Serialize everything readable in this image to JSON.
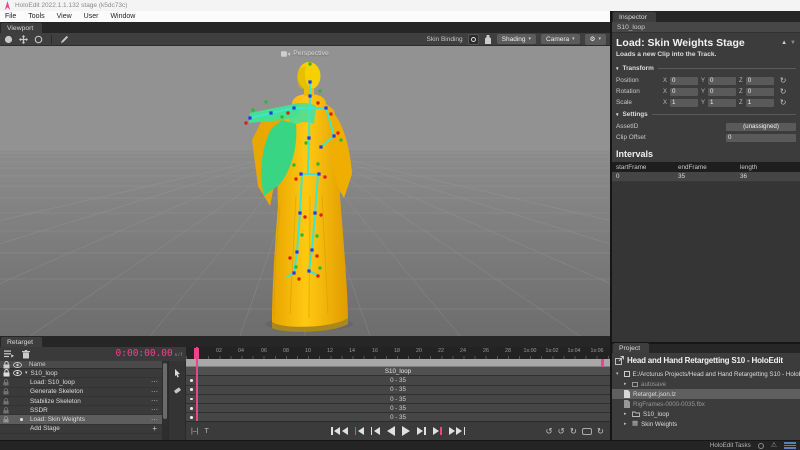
{
  "app": {
    "title": "HoloEdit 2022.1.1.132 stage (k5dc73c)"
  },
  "menu": {
    "items": [
      "File",
      "Tools",
      "View",
      "User",
      "Window"
    ]
  },
  "viewport": {
    "tab": "Viewport",
    "camera_label": "Perspective",
    "toolbar": {
      "skin_binding": "Skin Binding",
      "shading": "Shading",
      "camera": "Camera"
    }
  },
  "inspector": {
    "tab": "Inspector",
    "context": "S10_loop",
    "title": "Load: Skin Weights Stage",
    "subtitle": "Loads a new Clip into the Track.",
    "transform_section": "Transform",
    "axis_labels": {
      "x": "X",
      "y": "Y",
      "z": "Z"
    },
    "rows": [
      {
        "label": "Position",
        "x": "0",
        "y": "0",
        "z": "0"
      },
      {
        "label": "Rotation",
        "x": "0",
        "y": "0",
        "z": "0"
      },
      {
        "label": "Scale",
        "x": "1",
        "y": "1",
        "z": "1"
      }
    ],
    "settings_section": "Settings",
    "asset_id": {
      "label": "AssetID",
      "value": "(unassigned)"
    },
    "clip_offset": {
      "label": "Clip Offset",
      "value": "0"
    },
    "intervals": {
      "heading": "Intervals",
      "columns": [
        "startFrame",
        "endFrame",
        "length"
      ],
      "row": [
        "0",
        "35",
        "36"
      ]
    }
  },
  "retarget": {
    "tab": "Retarget",
    "timecode": "0:00:00.00",
    "timecode_units": "s / f",
    "name_header": "Name",
    "group_label": "S10_loop",
    "stages": [
      "Load: S10_loop",
      "Generate Skeleton",
      "Stabilize Skeleton",
      "SSDR",
      "Load: Skin Weights"
    ],
    "selected_stage": "Load: Skin Weights",
    "add_stage": "Add Stage",
    "more_glyph": "⋯",
    "plus_glyph": "+",
    "fit_glyph": "|–|",
    "text_tool_glyph": "T",
    "timeline": {
      "ticks": [
        "02",
        "04",
        "06",
        "08",
        "10",
        "12",
        "14",
        "16",
        "18",
        "20",
        "22",
        "24",
        "26",
        "28",
        "1s:00",
        "1s:02",
        "1s:04",
        "1s:06"
      ],
      "clip_label": "S10_loop",
      "range": "0 - 35"
    }
  },
  "project": {
    "tab": "Project",
    "title": "Head and Hand Retargetting S10 - HoloEdit",
    "root": "E:/Arcturus Projects/Head and Hand Retargetting S10 - HoloEdit",
    "items": [
      {
        "label": "autosave"
      },
      {
        "label": "Retarget.json.lz"
      },
      {
        "label": "RigFrames-0000-0035.fbx"
      },
      {
        "label": "S10_loop"
      },
      {
        "label": "Skin Weights"
      }
    ]
  },
  "status": {
    "tasks": "HoloEdit Tasks"
  },
  "colors": {
    "accent_pink": "#f0418c",
    "model_gold": "#f5b70a",
    "model_green": "#45e092",
    "skeleton_cyan": "#3ce6cf"
  },
  "icons": {
    "gear": "⚙",
    "warning": "⚠",
    "reset": "↻",
    "dropdown": "▾",
    "expand": "▸",
    "collapse": "▾",
    "up": "▲",
    "down": "▼",
    "grid": "▦",
    "undo": "↺",
    "redo": "↻"
  }
}
